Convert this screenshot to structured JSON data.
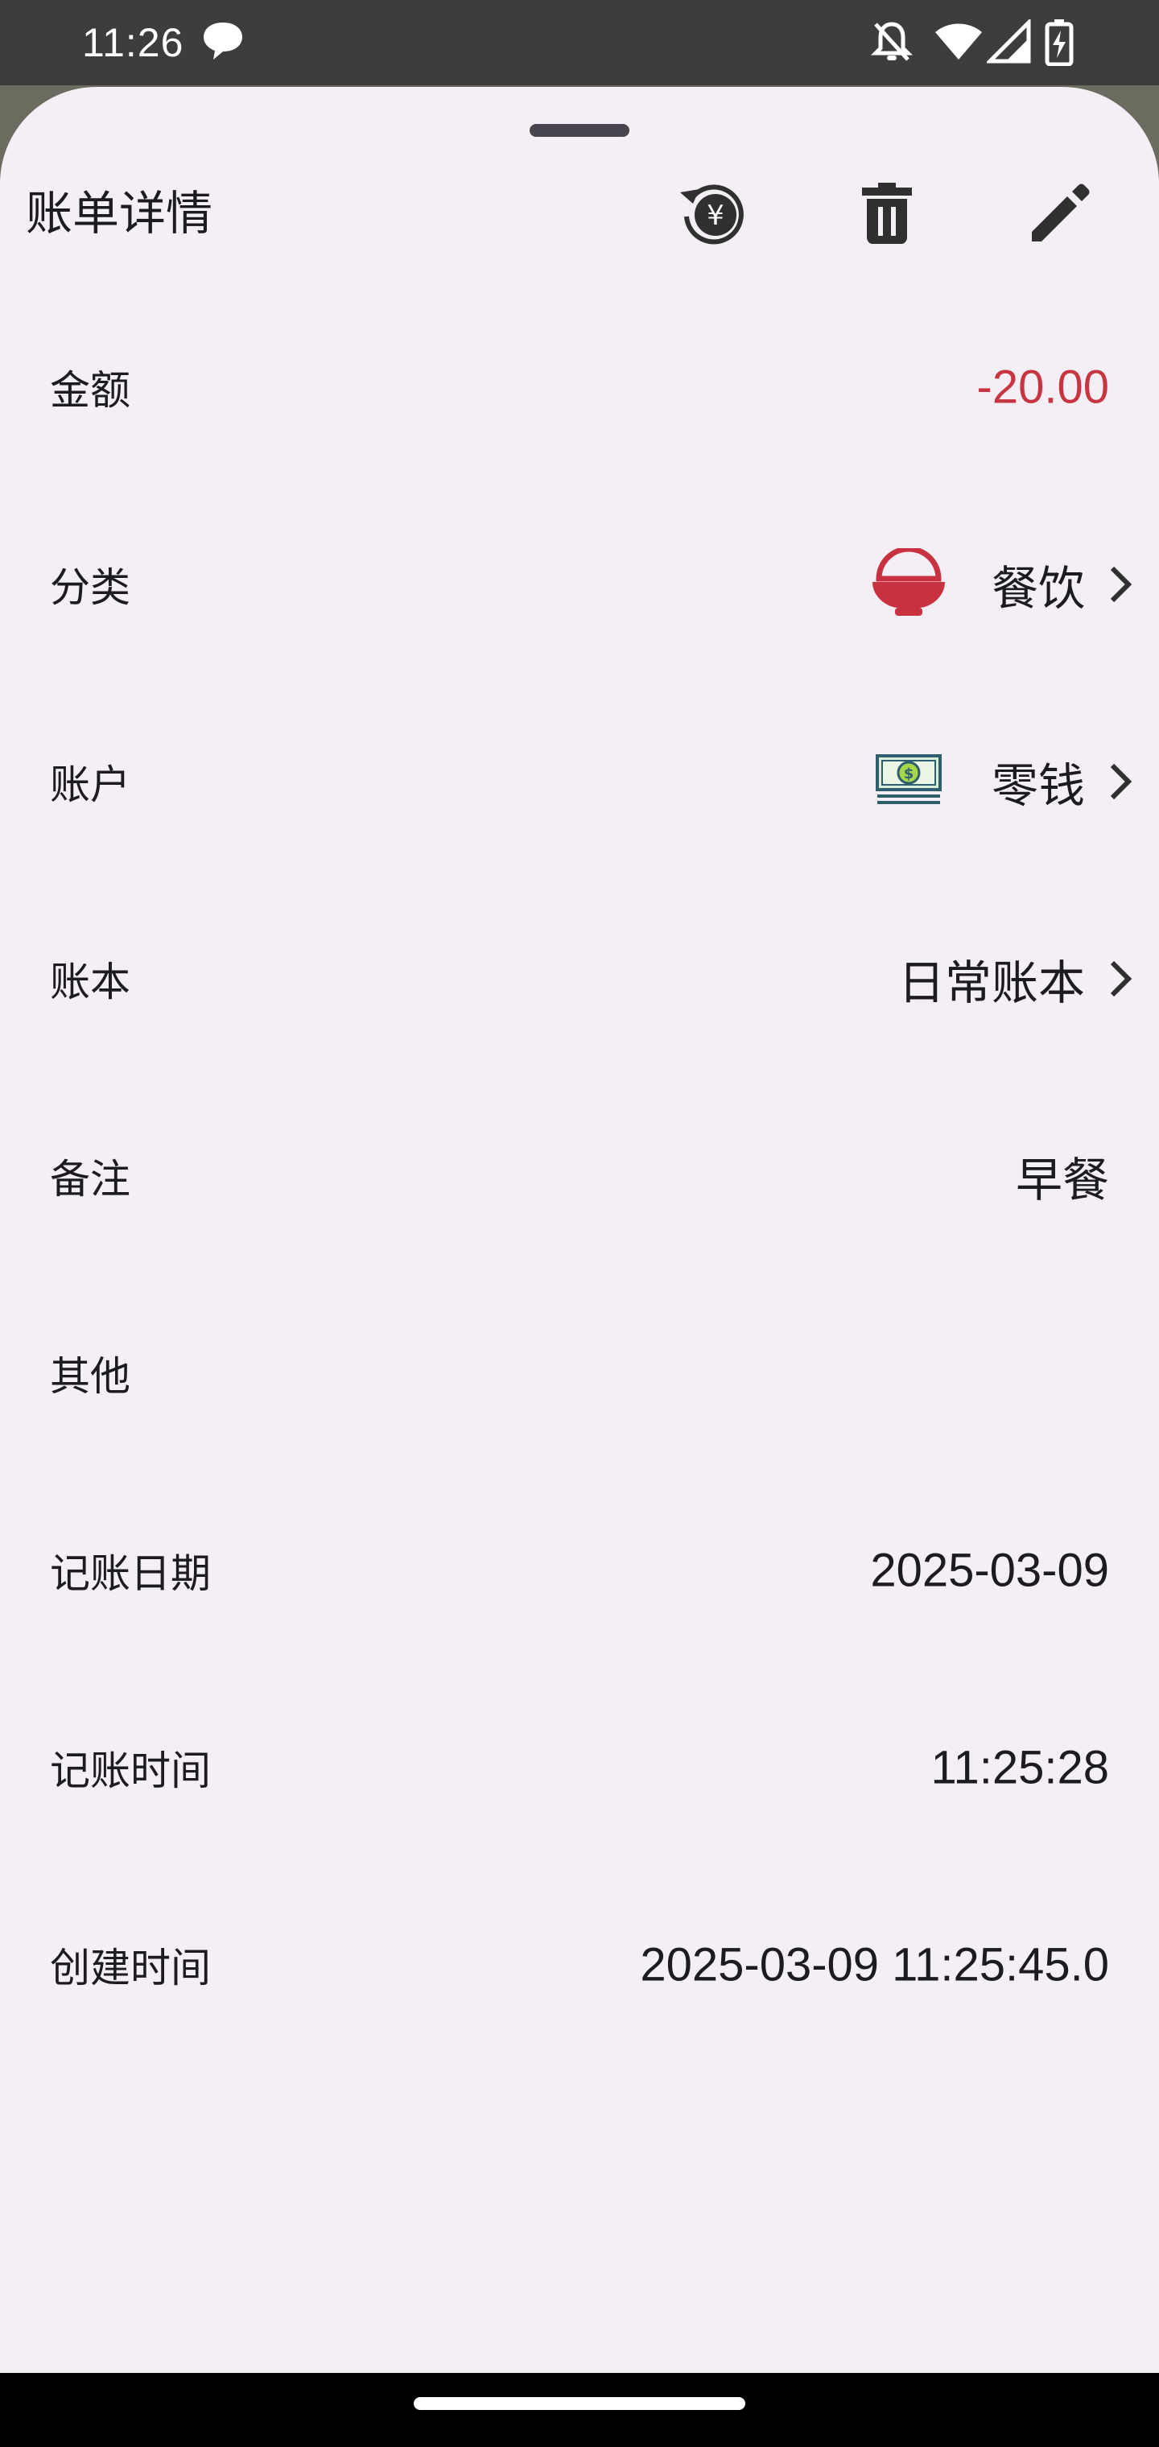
{
  "status_bar": {
    "time": "11:26",
    "icons": [
      "chat-bubble-icon",
      "notifications-off-icon",
      "wifi-icon",
      "signal-icon",
      "battery-charging-icon"
    ]
  },
  "sheet": {
    "title": "账单详情",
    "actions": [
      {
        "name": "refund",
        "icon": "yuan-refund-icon"
      },
      {
        "name": "delete",
        "icon": "trash-icon"
      },
      {
        "name": "edit",
        "icon": "pencil-icon"
      }
    ]
  },
  "rows": {
    "amount": {
      "label": "金额",
      "value": "-20.00",
      "color": "#c63541"
    },
    "category": {
      "label": "分类",
      "value": "餐饮",
      "icon": "rice-bowl-icon",
      "icon_color": "#c8313f"
    },
    "account": {
      "label": "账户",
      "value": "零钱",
      "icon": "cash-icon"
    },
    "book": {
      "label": "账本",
      "value": "日常账本"
    },
    "remark": {
      "label": "备注",
      "value": "早餐"
    },
    "other": {
      "label": "其他",
      "value": ""
    },
    "record_date": {
      "label": "记账日期",
      "value": "2025-03-09"
    },
    "record_time": {
      "label": "记账时间",
      "value": "11:25:28"
    },
    "created_at": {
      "label": "创建时间",
      "value": "2025-03-09 11:25:45.0"
    }
  },
  "colors": {
    "sheet_background": "#f4eff5",
    "text_primary": "#1c1b1f",
    "expense_red": "#c63541"
  }
}
